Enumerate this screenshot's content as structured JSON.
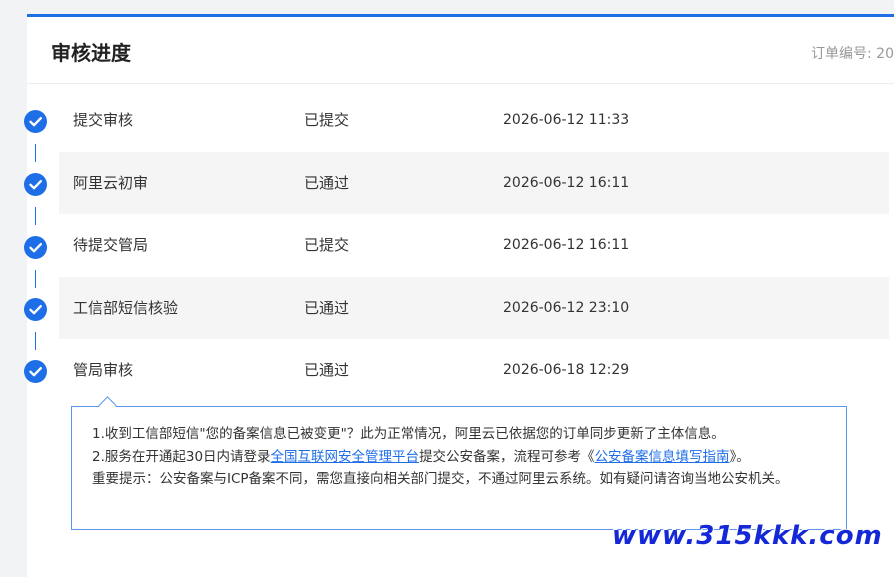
{
  "header": {
    "title": "审核进度",
    "order_label": "订单编号: 20"
  },
  "steps": [
    {
      "name": "提交审核",
      "status": "已提交",
      "time": "2026-06-12 11:33"
    },
    {
      "name": "阿里云初审",
      "status": "已通过",
      "time": "2026-06-12 16:11"
    },
    {
      "name": "待提交管局",
      "status": "已提交",
      "time": "2026-06-12 16:11"
    },
    {
      "name": "工信部短信核验",
      "status": "已通过",
      "time": "2026-06-12 23:10"
    },
    {
      "name": "管局审核",
      "status": "已通过",
      "time": "2026-06-18 12:29"
    }
  ],
  "notice": {
    "line1": "1.收到工信部短信\"您的备案信息已被变更\"？此为正常情况，阿里云已依据您的订单同步更新了主体信息。",
    "line2_prefix": "2.服务在开通起30日内请登录",
    "line2_link1": "全国互联网安全管理平台",
    "line2_middle": "提交公安备案，流程可参考《",
    "line2_link2": "公安备案信息填写指南",
    "line2_suffix": "》。",
    "line3": "重要提示：公安备案与ICP备案不同，需您直接向相关部门提交，不通过阿里云系统。如有疑问请咨询当地公安机关。"
  },
  "watermark": "www.315kkk.com",
  "colors": {
    "accent": "#1e6ee8",
    "row_shade": "#f5f5f6",
    "watermark": "#1428d8"
  },
  "icons": {
    "step_check": "check-circle-icon"
  }
}
